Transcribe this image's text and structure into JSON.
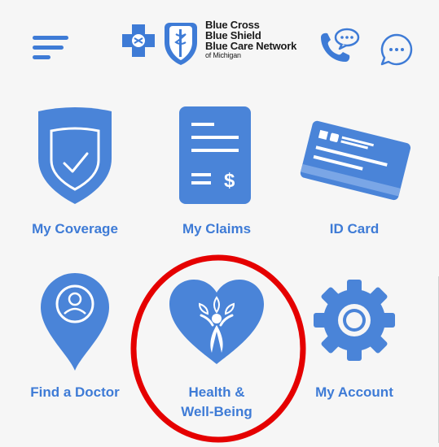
{
  "header": {
    "logo_line1": "Blue Cross",
    "logo_line2": "Blue Shield",
    "logo_line3": "Blue Care Network",
    "logo_line4": "of Michigan",
    "menu_icon": "hamburger-menu-icon",
    "call_icon": "phone-speech-icon",
    "chat_icon": "chat-bubble-icon"
  },
  "tiles": [
    {
      "label": "My Coverage",
      "icon": "shield-check-icon"
    },
    {
      "label": "My Claims",
      "icon": "claims-document-icon"
    },
    {
      "label": "ID Card",
      "icon": "id-card-icon"
    },
    {
      "label": "Find a Doctor",
      "icon": "doctor-pin-icon"
    },
    {
      "label_line1": "Health &",
      "label_line2": "Well-Being",
      "icon": "heart-wellbeing-icon"
    },
    {
      "label": "My Account",
      "icon": "gear-icon"
    }
  ],
  "colors": {
    "accent": "#3e7bd6",
    "icon_fill": "#4a84d8",
    "highlight_circle": "#e50000",
    "background": "#f6f6f6"
  }
}
